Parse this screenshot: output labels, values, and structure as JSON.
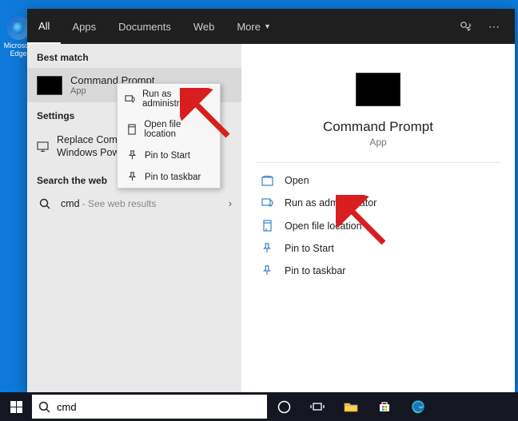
{
  "desktop": {
    "icon_label": "Microsoft Edge"
  },
  "tabs": {
    "all": "All",
    "apps": "Apps",
    "documents": "Documents",
    "web": "Web",
    "more": "More"
  },
  "left": {
    "best_head": "Best match",
    "best_title": "Command Prompt",
    "best_sub": "App",
    "settings_head": "Settings",
    "settings_item": "Replace Command Prompt with Windows PowerShell ...",
    "web_head": "Search the web",
    "web_query": "cmd",
    "web_suffix": "- See web results"
  },
  "context": {
    "run_admin": "Run as administrator",
    "open_loc": "Open file location",
    "pin_start": "Pin to Start",
    "pin_taskbar": "Pin to taskbar"
  },
  "preview": {
    "title": "Command Prompt",
    "sub": "App",
    "actions": {
      "open": "Open",
      "run_admin": "Run as administrator",
      "open_loc": "Open file location",
      "pin_start": "Pin to Start",
      "pin_taskbar": "Pin to taskbar"
    }
  },
  "taskbar": {
    "search_value": "cmd"
  }
}
